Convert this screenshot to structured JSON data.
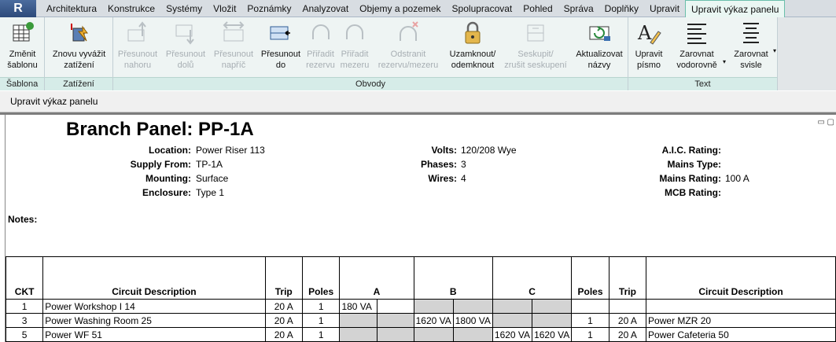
{
  "tabs": [
    "Architektura",
    "Konstrukce",
    "Systémy",
    "Vložit",
    "Poznámky",
    "Analyzovat",
    "Objemy a pozemek",
    "Spolupracovat",
    "Pohled",
    "Správa",
    "Doplňky",
    "Upravit",
    "Upravit výkaz panelu"
  ],
  "ribbon": {
    "sablona_panel": "Šablona",
    "zatizeni_panel": "Zatížení",
    "obvody_panel": "Obvody",
    "text_panel": "Text",
    "btn_change_template": "Změnit\nšablonu",
    "btn_rebalance": "Znovu vyvážit\nzatížení",
    "btn_move_up": "Přesunout\nnahoru",
    "btn_move_down": "Přesunout\ndolů",
    "btn_move_across": "Přesunout\nnapříč",
    "btn_move_to": "Přesunout\ndo",
    "btn_assign_spare": "Přiřadit\nrezervu",
    "btn_assign_space": "Přiřadit\nmezeru",
    "btn_remove_spare": "Odstranit\nrezervu/mezeru",
    "btn_lock": "Uzamknout/\nodemknout",
    "btn_group": "Seskupit/\nzrušit seskupení",
    "btn_update_names": "Aktualizovat\nnázvy",
    "btn_edit_font": "Upravit\npísmo",
    "btn_align_h": "Zarovnat\nvodorovně",
    "btn_align_v": "Zarovnat\nsvisle"
  },
  "subbar": {
    "label": "Upravit výkaz panelu"
  },
  "schedule": {
    "title": "Branch Panel: PP-1A",
    "info": {
      "location_label": "Location:",
      "location": "Power Riser 113",
      "supply_label": "Supply From:",
      "supply": "TP-1A",
      "mounting_label": "Mounting:",
      "mounting": "Surface",
      "enclosure_label": "Enclosure:",
      "enclosure": "Type 1",
      "volts_label": "Volts:",
      "volts": "120/208 Wye",
      "phases_label": "Phases:",
      "phases": "3",
      "wires_label": "Wires:",
      "wires": "4",
      "aic_label": "A.I.C. Rating:",
      "aic": "",
      "mains_type_label": "Mains Type:",
      "mains_type": "",
      "mains_rating_label": "Mains Rating:",
      "mains_rating": "100 A",
      "mcb_label": "MCB Rating:",
      "mcb": ""
    },
    "notes_label": "Notes:",
    "columns": [
      "CKT",
      "Circuit Description",
      "Trip",
      "Poles",
      "A",
      "B",
      "C",
      "Poles",
      "Trip",
      "Circuit Description"
    ],
    "rows": [
      {
        "ckt": "1",
        "desc": "Power Workshop I 14",
        "trip": "20 A",
        "poles": "1",
        "a1": "180 VA",
        "a2": "",
        "b1": "",
        "b2": "",
        "c1": "",
        "c2": "",
        "poles_r": "",
        "trip_r": "",
        "desc_r": ""
      },
      {
        "ckt": "3",
        "desc": "Power Washing Room 25",
        "trip": "20 A",
        "poles": "1",
        "a1": "",
        "a2": "",
        "b1": "1620 VA",
        "b2": "1800 VA",
        "c1": "",
        "c2": "",
        "poles_r": "1",
        "trip_r": "20 A",
        "desc_r": "Power MZR 20"
      },
      {
        "ckt": "5",
        "desc": "Power WF 51",
        "trip": "20 A",
        "poles": "1",
        "a1": "",
        "a2": "",
        "b1": "",
        "b2": "",
        "c1": "1620 VA",
        "c2": "1620 VA",
        "poles_r": "1",
        "trip_r": "20 A",
        "desc_r": "Power Cafeteria 50"
      }
    ]
  },
  "colors": {
    "ribbon_bg": "#eef4f3",
    "active_tab": "#eaf7f3",
    "gray_cell": "#d3d3d3"
  }
}
